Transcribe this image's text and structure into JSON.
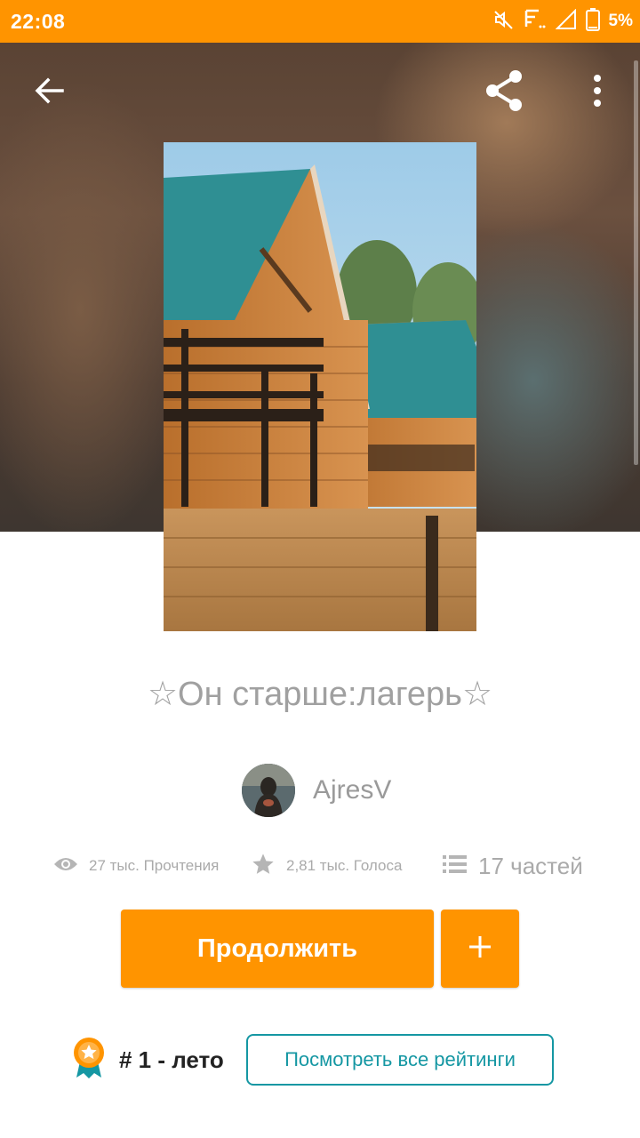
{
  "status_bar": {
    "time": "22:08",
    "battery": "5%",
    "icons": [
      "mute-icon",
      "signal-icon",
      "cell-signal-icon",
      "battery-icon"
    ]
  },
  "toolbar": {
    "back_icon": "arrow-left-icon",
    "share_icon": "share-icon",
    "more_icon": "more-vertical-icon"
  },
  "story": {
    "title": "☆Он старше:лагерь☆",
    "cover_icon": "book-cover-image",
    "author": {
      "name": "AjresV",
      "avatar_icon": "avatar"
    },
    "stats": {
      "reads": "27 тыс. Прочтения",
      "votes": "2,81 тыс. Голоса",
      "parts": "17 частей"
    }
  },
  "actions": {
    "continue_label": "Продолжить",
    "add_label": "+"
  },
  "ranking": {
    "rank_text": "# 1 - лето",
    "view_all_label": "Посмотреть все рейтинги"
  },
  "colors": {
    "accent": "#ff9400",
    "teal": "#1597a3",
    "muted_text": "#a0a0a0"
  }
}
